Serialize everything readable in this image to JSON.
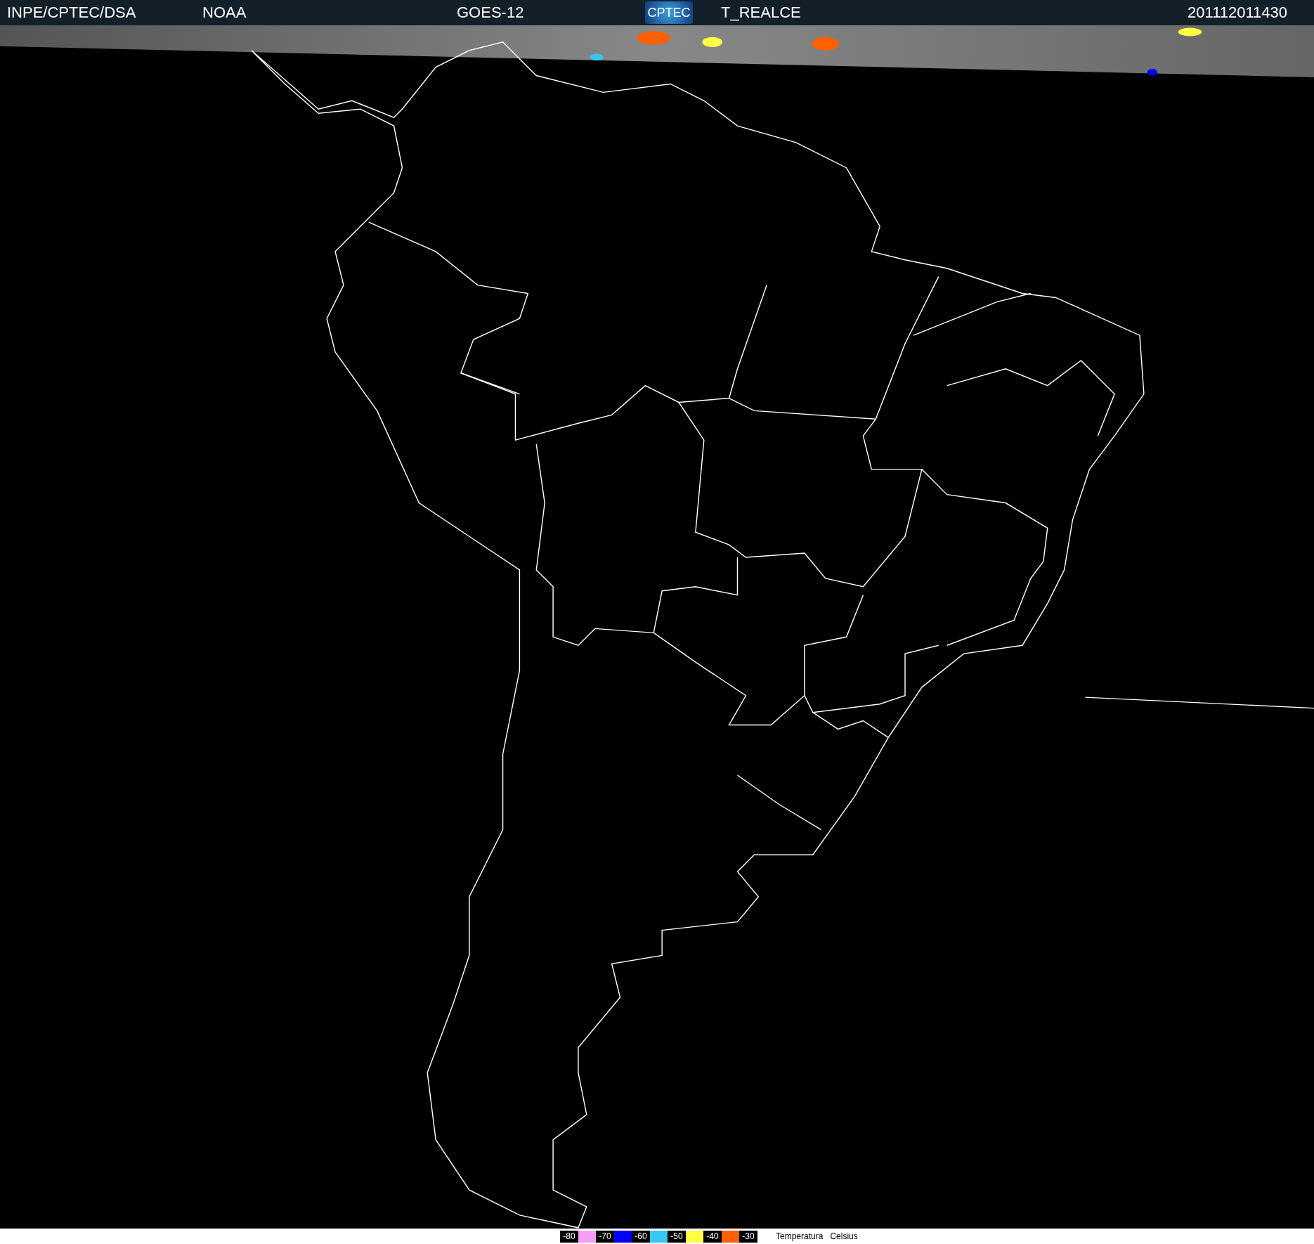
{
  "header": {
    "source": "INPE/CPTEC/DSA",
    "agency": "NOAA",
    "satellite": "GOES-12",
    "logo": "CPTEC",
    "product": "T_REALCE",
    "timestamp": "201112011430"
  },
  "legend": {
    "items": [
      {
        "label": "-80",
        "color": "#f59ef5"
      },
      {
        "label": "-70",
        "color": "#0000ff"
      },
      {
        "label": "-60",
        "color": "#33c8f5"
      },
      {
        "label": "-50",
        "color": "#ffff44"
      },
      {
        "label": "-40",
        "color": "#ff6000"
      },
      {
        "label": "-30"
      }
    ],
    "title": "Temperatura",
    "unit": "Celsius"
  }
}
